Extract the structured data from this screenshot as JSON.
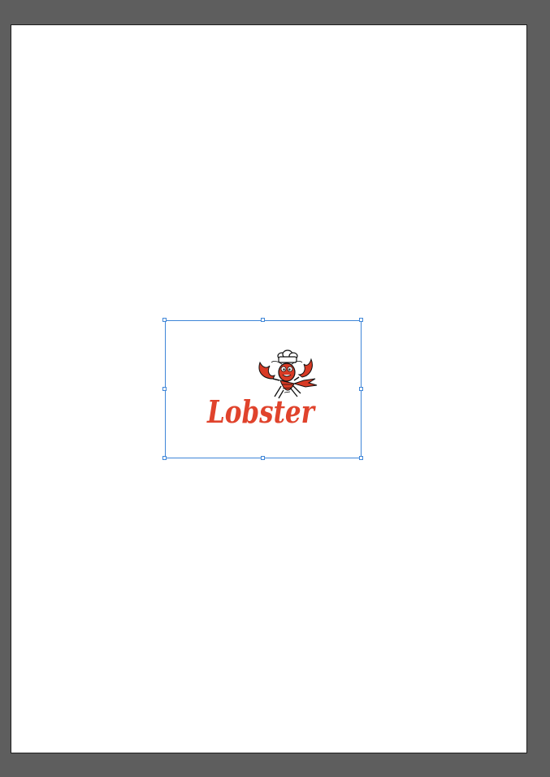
{
  "document": {
    "logo": {
      "text": "Lobster",
      "icon": "lobster-chef-icon",
      "text_color": "#e0432c",
      "body_color": "#d83a25",
      "hat_color": "#ffffff",
      "outline_color": "#111111"
    },
    "selection": {
      "color": "#3f86d8"
    },
    "colors": {
      "workspace": "#5e5e5e",
      "artboard": "#ffffff"
    }
  }
}
